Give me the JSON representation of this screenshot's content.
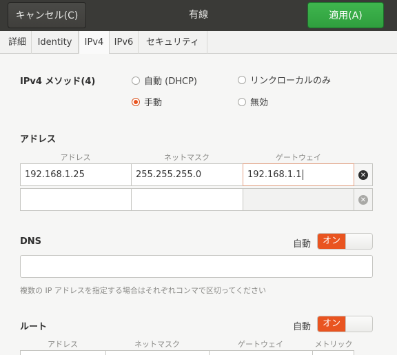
{
  "header": {
    "cancel_label": "キャンセル(C)",
    "title": "有線",
    "apply_label": "適用(A)"
  },
  "tabs": [
    {
      "label": "詳細"
    },
    {
      "label": "Identity"
    },
    {
      "label": "IPv4",
      "active": true
    },
    {
      "label": "IPv6"
    },
    {
      "label": "セキュリティ"
    }
  ],
  "ipv4": {
    "method_label": "IPv4 メソッド(4)",
    "options": {
      "dhcp": "自動 (DHCP)",
      "link_local": "リンクローカルのみ",
      "manual": "手動",
      "disabled": "無効"
    },
    "selected": "manual"
  },
  "addresses": {
    "section_label": "アドレス",
    "columns": [
      "アドレス",
      "ネットマスク",
      "ゲートウェイ"
    ],
    "rows": [
      {
        "address": "192.168.1.25",
        "netmask": "255.255.255.0",
        "gateway": "192.168.1.1"
      },
      {
        "address": "",
        "netmask": "",
        "gateway": ""
      }
    ]
  },
  "dns": {
    "section_label": "DNS",
    "auto_label": "自動",
    "switch_label": "オン",
    "value": "",
    "hint": "複数の IP アドレスを指定する場合はそれぞれコンマで区切ってください"
  },
  "routes": {
    "section_label": "ルート",
    "auto_label": "自動",
    "switch_label": "オン",
    "columns": [
      "アドレス",
      "ネットマスク",
      "ゲートウェイ",
      "メトリック"
    ]
  },
  "colors": {
    "accent": "#e95420",
    "apply_green": "#34a843",
    "header_bg": "#3a3a37"
  }
}
